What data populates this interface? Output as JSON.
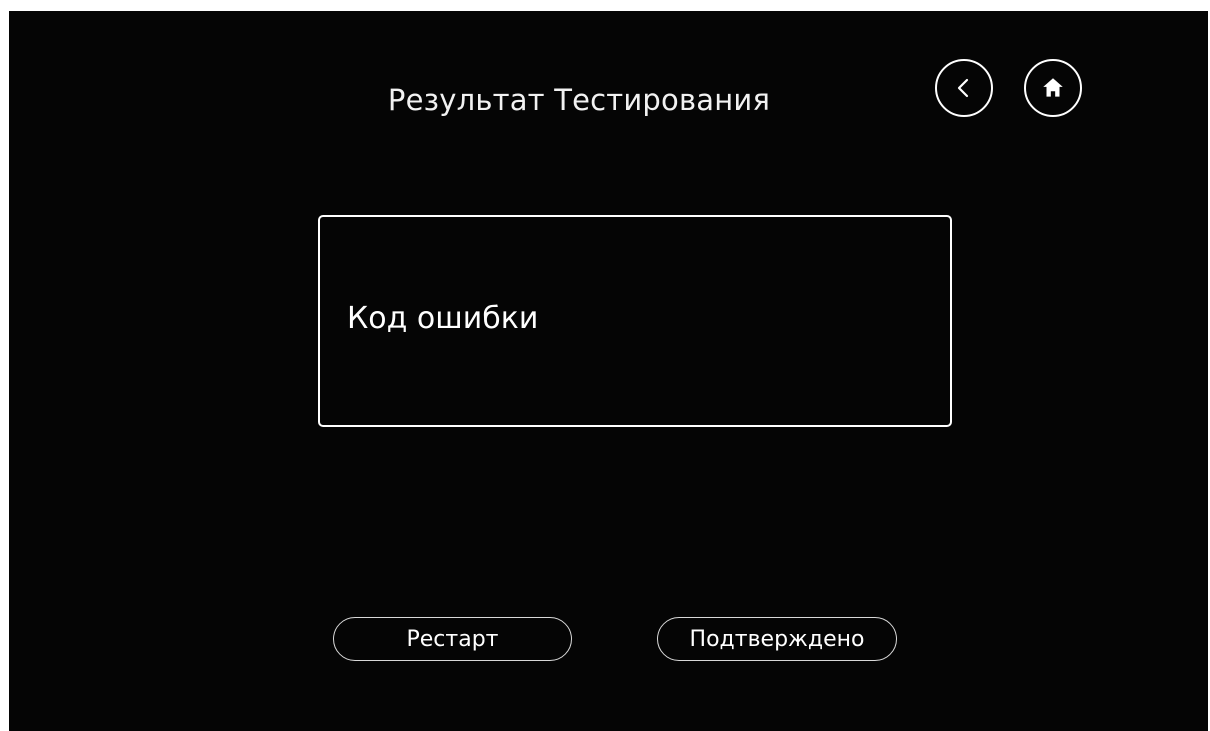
{
  "header": {
    "title": "Результат Тестирования",
    "back_icon": "chevron-left-circle",
    "home_icon": "home"
  },
  "result": {
    "label": "Код ошибки"
  },
  "actions": {
    "restart_label": "Рестарт",
    "confirm_label": "Подтверждено"
  },
  "colors": {
    "background": "#050505",
    "foreground": "#ffffff"
  }
}
